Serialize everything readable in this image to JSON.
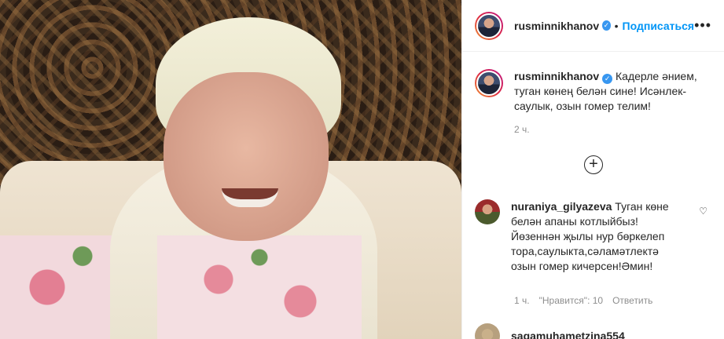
{
  "post": {
    "username": "rusminnikhanov",
    "follow_label": "Подписаться",
    "more_label": "•••",
    "caption": "Кадерле әнием, туган көнең белән сине! Исәнлек-саулык, озын гомер телим!",
    "time": "2 ч."
  },
  "comments": [
    {
      "username": "nuraniya_gilyazeva",
      "text": "Туган көне белән апаны котлыйбыз!Йөзеннән җылы нур бөркелеп тора,саулыкта,сәламәтлектә озын гомер кичерсен!Әмин!",
      "time": "1 ч.",
      "likes": "\"Нравится\": 10",
      "reply": "Ответить"
    },
    {
      "username": "sagamuhametzina554"
    }
  ],
  "icons": {
    "verified": "verified-badge-icon",
    "load_more": "plus-circle-icon",
    "heart": "heart-icon"
  },
  "colors": {
    "link": "#0095f6",
    "verified": "#3897f0",
    "muted": "#8e8e8e"
  }
}
